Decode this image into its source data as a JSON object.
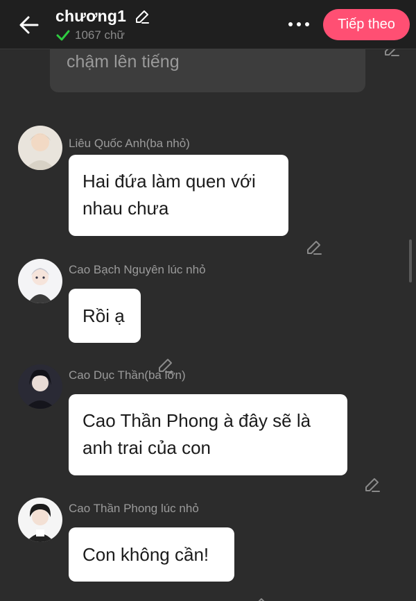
{
  "header": {
    "title": "chương1",
    "word_count": "1067 chữ",
    "next_label": "Tiếp theo"
  },
  "previous_message": {
    "text": "chậm lên tiếng"
  },
  "messages": [
    {
      "name": "Liêu Quốc Anh(ba nhỏ)",
      "lines": [
        "Hai đứa làm quen với",
        "nhau chưa"
      ]
    },
    {
      "name": "Cao Bạch Nguyên lúc nhỏ",
      "lines": [
        "Rồi ạ"
      ]
    },
    {
      "name": "Cao Dục Thần(ba lớn)",
      "lines": [
        "Cao Thần Phong à đây sẽ là",
        "anh trai của con"
      ]
    },
    {
      "name": "Cao Thần Phong lúc nhỏ",
      "lines": [
        "Con không cần!"
      ]
    }
  ],
  "colors": {
    "accent": "#ff4f73",
    "check": "#2ecc40",
    "background": "#2c2c2c"
  }
}
